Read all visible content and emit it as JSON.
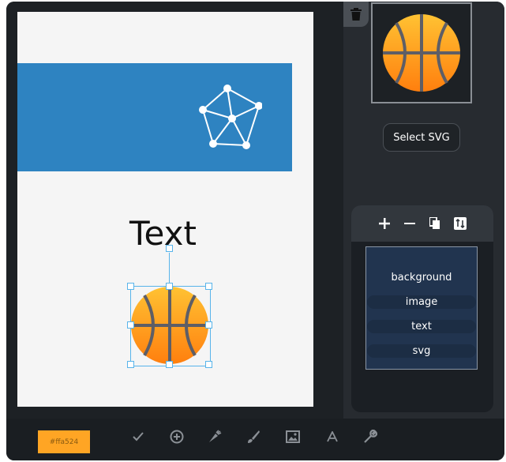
{
  "canvas": {
    "text": "Text"
  },
  "sidebar": {
    "select_svg_label": "Select SVG"
  },
  "layers": {
    "items": [
      "background",
      "image",
      "text",
      "svg"
    ]
  },
  "bottom_bar": {
    "color_hex": "#ffa524",
    "tools": [
      "check-icon",
      "add-circle-icon",
      "carrot-icon",
      "brush-icon",
      "image-icon",
      "font-icon",
      "wrench-icon"
    ]
  },
  "colors": {
    "accent": "#ffa524",
    "banner": "#2e83c1",
    "selection": "#58b4ea"
  }
}
